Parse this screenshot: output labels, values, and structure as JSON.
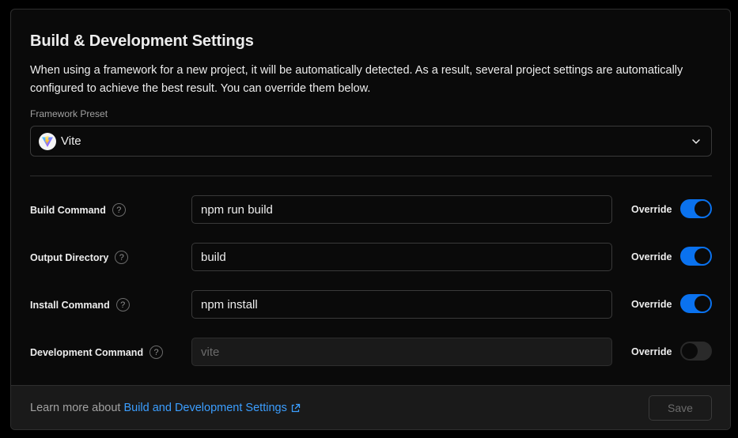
{
  "section": {
    "title": "Build & Development Settings",
    "description": "When using a framework for a new project, it will be automatically detected. As a result, several project settings are automatically configured to achieve the best result. You can override them below."
  },
  "framework": {
    "label": "Framework Preset",
    "selected": "Vite",
    "icon": "vite-logo-icon"
  },
  "settings": [
    {
      "label": "Build Command",
      "value": "npm run build",
      "placeholder": "",
      "override_label": "Override",
      "override": true
    },
    {
      "label": "Output Directory",
      "value": "build",
      "placeholder": "",
      "override_label": "Override",
      "override": true
    },
    {
      "label": "Install Command",
      "value": "npm install",
      "placeholder": "",
      "override_label": "Override",
      "override": true
    },
    {
      "label": "Development Command",
      "value": "",
      "placeholder": "vite",
      "override_label": "Override",
      "override": false
    }
  ],
  "help_glyph": "?",
  "footer": {
    "learn_prefix": "Learn more about",
    "learn_link": "Build and Development Settings",
    "save_label": "Save"
  },
  "colors": {
    "accent": "#0a72ef",
    "link": "#3b9eff",
    "background": "#0a0a0a"
  }
}
